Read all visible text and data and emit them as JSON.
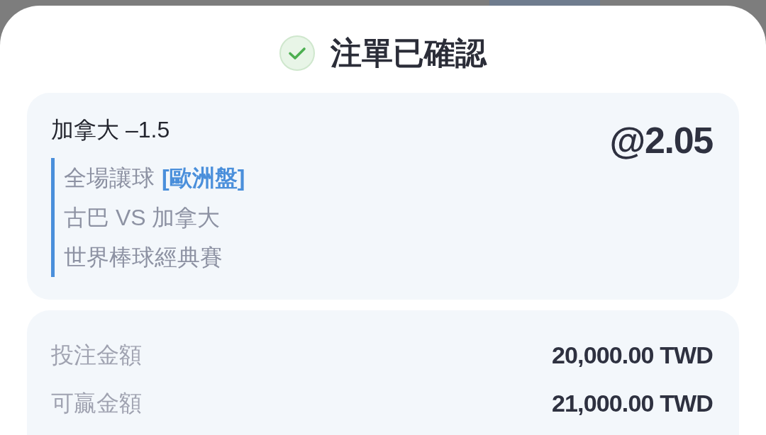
{
  "sheet": {
    "title": "注單已確認"
  },
  "bet_card": {
    "selection": "加拿大 –1.5",
    "odds": "@2.05",
    "market": "全場讓球",
    "market_type": "[歐洲盤]",
    "match": "古巴 VS 加拿大",
    "league": "世界棒球經典賽"
  },
  "summary": {
    "rows": [
      {
        "label": "投注金額",
        "value": "20,000.00 TWD"
      },
      {
        "label": "可贏金額",
        "value": "21,000.00 TWD"
      }
    ]
  }
}
